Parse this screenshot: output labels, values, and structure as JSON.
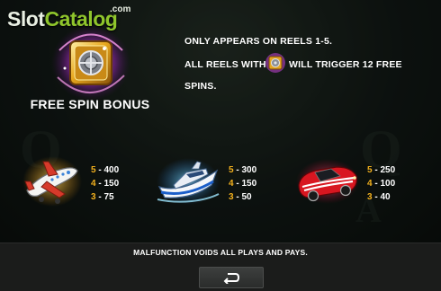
{
  "logo": {
    "slot": "Slot",
    "catalog": "Catalog",
    "com": ".com"
  },
  "free_spin": {
    "title": "FREE SPIN BONUS",
    "line1": "ONLY APPEARS ON REELS 1-5.",
    "line2a": "ALL REELS WITH",
    "line2b": "WILL TRIGGER 12 FREE",
    "line3": "SPINS.",
    "icon": "vault-icon"
  },
  "paytable": [
    {
      "symbol": "airplane-icon",
      "pays": [
        {
          "count": "5",
          "value": "400"
        },
        {
          "count": "4",
          "value": "150"
        },
        {
          "count": "3",
          "value": "75"
        }
      ]
    },
    {
      "symbol": "yacht-icon",
      "pays": [
        {
          "count": "5",
          "value": "300"
        },
        {
          "count": "4",
          "value": "150"
        },
        {
          "count": "3",
          "value": "50"
        }
      ]
    },
    {
      "symbol": "sports-car-icon",
      "pays": [
        {
          "count": "5",
          "value": "250"
        },
        {
          "count": "4",
          "value": "100"
        },
        {
          "count": "3",
          "value": "40"
        }
      ]
    }
  ],
  "footer": {
    "notice": "MALFUNCTION VOIDS ALL PLAYS AND PAYS.",
    "back_icon": "return-arrow-icon"
  },
  "colors": {
    "pay_count": "#f2b01d",
    "text": "#ffffff",
    "logo_green": "#8fc52c"
  }
}
